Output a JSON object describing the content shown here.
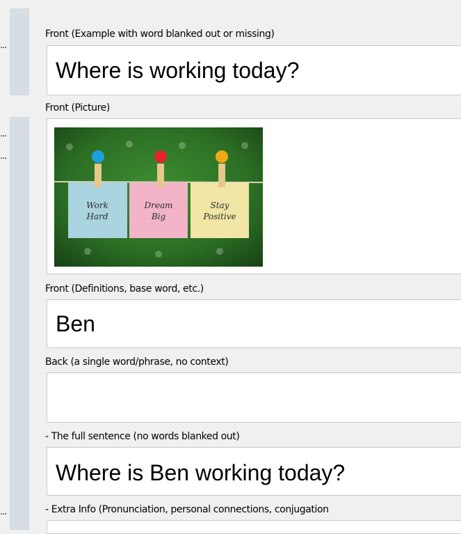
{
  "fields": [
    {
      "label": "Front (Example with word blanked out or missing)",
      "value": "Where is working today?"
    },
    {
      "label": "Front (Picture)",
      "value": ""
    },
    {
      "label": "Front (Definitions, base word, etc.)",
      "value": "Ben"
    },
    {
      "label": "Back (a single word/phrase, no context)",
      "value": ""
    },
    {
      "label": "- The full sentence (no words blanked out)",
      "value": "Where is Ben working today?"
    },
    {
      "label": "- Extra Info (Pronunciation, personal connections, conjugation",
      "value": ""
    }
  ],
  "side_markers": [
    "...",
    "...",
    "...",
    "..."
  ],
  "picture": {
    "notes": [
      {
        "line1": "Work",
        "line2": "Hard",
        "color": "#a9d4e0"
      },
      {
        "line1": "Dream",
        "line2": "Big",
        "color": "#f2b4c6"
      },
      {
        "line1": "Stay",
        "line2": "Positive",
        "color": "#f2e6a6"
      }
    ],
    "pin_colors": [
      "#1e9ee0",
      "#e0262a",
      "#f0a818"
    ]
  }
}
